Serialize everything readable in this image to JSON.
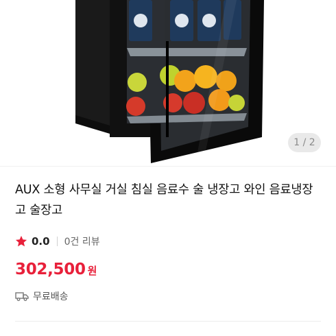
{
  "product": {
    "image_alt": "mini fridge with glass door",
    "pager": "1 / 2",
    "title": "AUX 소형 사무실 거실 침실 음료수 술 냉장고 와인 음료냉장고 술장고",
    "rating": {
      "score": "0.0",
      "reviews": "0건 리뷰"
    },
    "price": {
      "amount": "302,500",
      "unit": "원",
      "color": "#e8203a"
    },
    "shipping": "무료배송"
  }
}
